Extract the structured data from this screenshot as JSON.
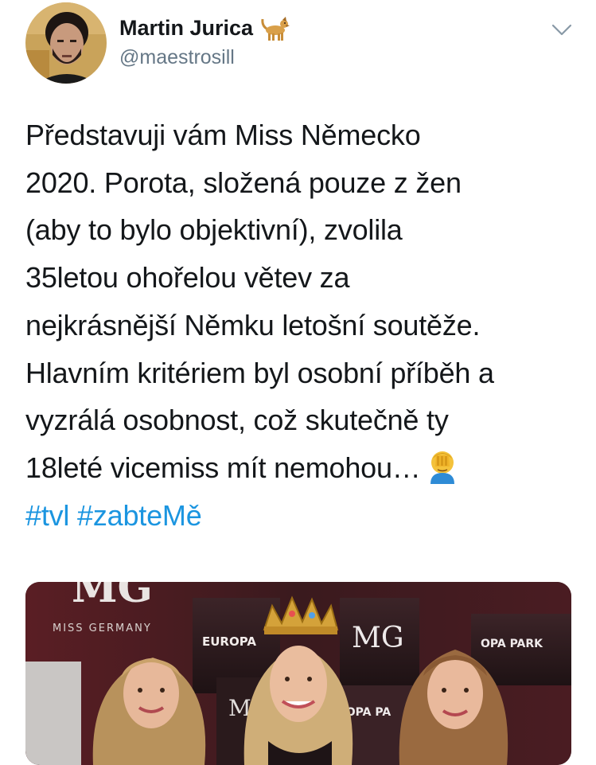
{
  "author": {
    "display_name": "Martin Jurica",
    "handle": "@maestrosill",
    "badge_icon": "dog-emoji-icon"
  },
  "tweet": {
    "lines": [
      "Představuji vám Miss Německo",
      "2020. Porota, složená pouze z žen",
      "(aby to bylo objektivní), zvolila",
      "35letou ohořelou větev za",
      "nejkrásnější Němku letošní soutěže.",
      "Hlavním kritériem byl osobní příběh a",
      "vyzrálá osobnost, což skutečně ty",
      "18leté vicemiss mít nemohou…"
    ],
    "trailing_emoji": "facepalm-emoji-icon",
    "hashtags": [
      "#tvl",
      "#zabteMě"
    ]
  },
  "media": {
    "backdrop_texts": {
      "mg_logo_large": "MG",
      "miss_germany": "MISS GERMANY",
      "europa_park": "EUROPA",
      "mg_logo_center": "MG",
      "opa_park": "OPA PARK",
      "ropa_pa": "ROPA PA",
      "mg_small": "M"
    }
  },
  "colors": {
    "text": "#14171a",
    "secondary": "#657786",
    "link": "#1b95e0",
    "backdrop": "#2a1418"
  }
}
